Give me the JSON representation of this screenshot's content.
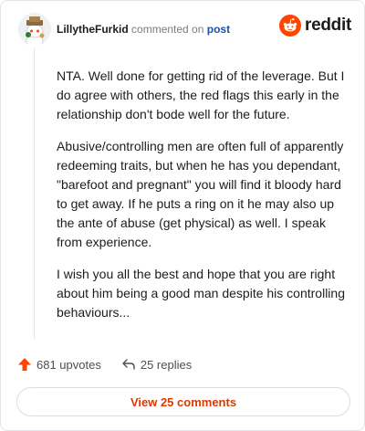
{
  "header": {
    "username": "LillytheFurkid",
    "action_text": "commented on",
    "post_link": "post",
    "brand_name": "reddit",
    "icons": {
      "avatar": "user-avatar",
      "logo": "reddit-snoo-icon"
    }
  },
  "comment": {
    "paragraphs": [
      "NTA. Well done for getting rid of the leverage. But I do agree with others, the red flags this early in the relationship don't bode well for the future.",
      "Abusive/controlling men are often full of apparently redeeming traits, but when he has you dependant, \"barefoot and pregnant\" you will find it bloody hard to get away. If he puts a ring on it he may also up the ante of abuse (get physical) as well. I speak from experience.",
      "I wish you all the best and hope that you are right about him being a good man despite his controlling behaviours..."
    ]
  },
  "actions": {
    "upvotes_label": "681 upvotes",
    "replies_label": "25 replies",
    "view_comments_label": "View 25 comments"
  },
  "colors": {
    "accent": "#ff4500",
    "view_button_text": "#d93a00",
    "post_link": "#1a4fa8"
  }
}
